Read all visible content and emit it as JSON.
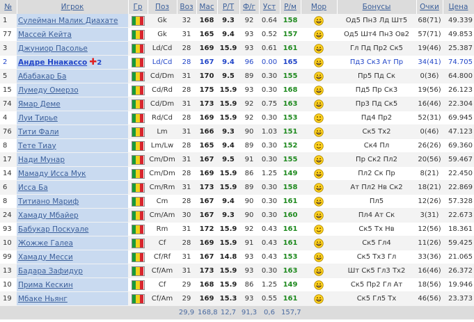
{
  "headers": {
    "num": "№",
    "player": "Игрок",
    "country": "Гр",
    "pos": "Поз",
    "age": "Воз",
    "mas": "Мас",
    "rt": "Р/Т",
    "fg": "Ф/г",
    "ust": "Уст",
    "rm": "Р/м",
    "mor": "Мор",
    "bonus": "Бонусы",
    "points": "Очки",
    "price": "Цена"
  },
  "flag_colors": [
    "#1a9a3a",
    "#f1d21b",
    "#d8262e"
  ],
  "rows": [
    {
      "num": "1",
      "name": "Сулейман Малик Диахате",
      "pos": "Gk",
      "age": "32",
      "mas": "168",
      "rt": "9.3",
      "fg": "92",
      "ust": "0.64",
      "rm": "158",
      "mor": "happy",
      "bonus": "Од5 Пн3 Лд Шт5",
      "points": "68(71)",
      "price": "49.339"
    },
    {
      "num": "77",
      "name": "Массей Кейта",
      "pos": "Gk",
      "age": "31",
      "mas": "165",
      "rt": "9.4",
      "fg": "93",
      "ust": "0.52",
      "rm": "157",
      "mor": "happy",
      "bonus": "Од5 Шт4 Пн3 Ов2",
      "points": "57(71)",
      "price": "49.853"
    },
    {
      "num": "3",
      "name": "Джуниор Пасолье",
      "pos": "Ld/Cd",
      "age": "28",
      "mas": "169",
      "rt": "15.9",
      "fg": "93",
      "ust": "0.61",
      "rm": "161",
      "mor": "happy",
      "bonus": "Гл Пд Пр2 Ск5",
      "points": "19(46)",
      "price": "25.387"
    },
    {
      "num": "2",
      "name": "Андре Ннакассо",
      "badge": "2",
      "pos": "Ld/Cd",
      "age": "28",
      "mas": "167",
      "rt": "9.4",
      "fg": "96",
      "ust": "0.00",
      "rm": "165",
      "mor": "happy",
      "bonus": "Пд3 Ск3 Ат Пр",
      "points": "34(41)",
      "price": "74.705",
      "highlight": true
    },
    {
      "num": "5",
      "name": "Абабакар Ба",
      "pos": "Cd/Dm",
      "age": "31",
      "mas": "170",
      "rt": "9.5",
      "fg": "89",
      "ust": "0.30",
      "rm": "155",
      "mor": "happy",
      "bonus": "Пр5 Пд Ск",
      "points": "0(36)",
      "price": "64.800"
    },
    {
      "num": "15",
      "name": "Лумеду Омерзо",
      "pos": "Cd/Rd",
      "age": "28",
      "mas": "175",
      "rt": "15.9",
      "fg": "93",
      "ust": "0.30",
      "rm": "168",
      "mor": "happy",
      "bonus": "Пд5 Пр Ск3",
      "points": "19(56)",
      "price": "26.123"
    },
    {
      "num": "74",
      "name": "Ямар Деме",
      "pos": "Cd/Dm",
      "age": "31",
      "mas": "173",
      "rt": "15.9",
      "fg": "92",
      "ust": "0.75",
      "rm": "163",
      "mor": "happy",
      "bonus": "Пр3 Пд Ск5",
      "points": "16(46)",
      "price": "22.304"
    },
    {
      "num": "4",
      "name": "Луи Тирье",
      "pos": "Rd/Cd",
      "age": "28",
      "mas": "169",
      "rt": "15.9",
      "fg": "92",
      "ust": "0.30",
      "rm": "153",
      "mor": "smile",
      "bonus": "Пд4 Пр2",
      "points": "52(31)",
      "price": "69.945"
    },
    {
      "num": "76",
      "name": "Тити Фали",
      "pos": "Lm",
      "age": "31",
      "mas": "166",
      "rt": "9.3",
      "fg": "90",
      "ust": "1.03",
      "rm": "151",
      "mor": "happy",
      "bonus": "Ск5 Тх2",
      "points": "0(46)",
      "price": "47.123"
    },
    {
      "num": "8",
      "name": "Тете Тиау",
      "pos": "Lm/Lw",
      "age": "28",
      "mas": "165",
      "rt": "9.4",
      "fg": "89",
      "ust": "0.30",
      "rm": "152",
      "mor": "smile",
      "bonus": "Ск4 Пл",
      "points": "26(26)",
      "price": "69.360"
    },
    {
      "num": "17",
      "name": "Нади Мунар",
      "pos": "Cm/Dm",
      "age": "31",
      "mas": "167",
      "rt": "9.5",
      "fg": "91",
      "ust": "0.30",
      "rm": "155",
      "mor": "happy",
      "bonus": "Пр Ск2 Пл2",
      "points": "20(56)",
      "price": "59.467"
    },
    {
      "num": "14",
      "name": "Мамаду Исса Мук",
      "pos": "Cm/Dm",
      "age": "28",
      "mas": "169",
      "rt": "15.9",
      "fg": "86",
      "ust": "1.25",
      "rm": "149",
      "mor": "happy",
      "bonus": "Пл2 Ск Пр",
      "points": "8(21)",
      "price": "22.450"
    },
    {
      "num": "6",
      "name": "Исса Ба",
      "pos": "Cm/Rm",
      "age": "31",
      "mas": "173",
      "rt": "15.9",
      "fg": "89",
      "ust": "0.30",
      "rm": "158",
      "mor": "happy",
      "bonus": "Ат Пл2 Нв Ск2",
      "points": "18(21)",
      "price": "22.869"
    },
    {
      "num": "8",
      "name": "Титиано Мариф",
      "pos": "Cm",
      "age": "28",
      "mas": "167",
      "rt": "9.4",
      "fg": "90",
      "ust": "0.30",
      "rm": "161",
      "mor": "happy",
      "bonus": "Пл5",
      "points": "12(26)",
      "price": "57.328"
    },
    {
      "num": "24",
      "name": "Хамаду Мбайер",
      "pos": "Cm/Am",
      "age": "30",
      "mas": "167",
      "rt": "9.3",
      "fg": "90",
      "ust": "0.30",
      "rm": "160",
      "mor": "happy",
      "bonus": "Пл4 Ат Ск",
      "points": "3(31)",
      "price": "22.673"
    },
    {
      "num": "93",
      "name": "Бабукар Поскуале",
      "pos": "Rm",
      "age": "31",
      "mas": "172",
      "rt": "15.9",
      "fg": "92",
      "ust": "0.43",
      "rm": "161",
      "mor": "smile",
      "bonus": "Ск5 Тх Нв",
      "points": "12(56)",
      "price": "18.361"
    },
    {
      "num": "10",
      "name": "Жожже Галеа",
      "pos": "Cf",
      "age": "28",
      "mas": "169",
      "rt": "15.9",
      "fg": "91",
      "ust": "0.43",
      "rm": "161",
      "mor": "happy",
      "bonus": "Ск5 Гл4",
      "points": "11(26)",
      "price": "59.425"
    },
    {
      "num": "99",
      "name": "Хамаду Месси",
      "pos": "Cf/Rf",
      "age": "31",
      "mas": "167",
      "rt": "14.8",
      "fg": "93",
      "ust": "0.43",
      "rm": "153",
      "mor": "happy",
      "bonus": "Ск5 Тх3 Гл",
      "points": "33(36)",
      "price": "21.065"
    },
    {
      "num": "13",
      "name": "Бадара Зафидур",
      "pos": "Cf/Am",
      "age": "31",
      "mas": "173",
      "rt": "15.9",
      "fg": "93",
      "ust": "0.30",
      "rm": "163",
      "mor": "happy",
      "bonus": "Шт Ск5 Гл3 Тх2",
      "points": "16(46)",
      "price": "26.372"
    },
    {
      "num": "10",
      "name": "Прима Кескин",
      "pos": "Cf",
      "age": "29",
      "mas": "168",
      "rt": "15.9",
      "fg": "86",
      "ust": "1.25",
      "rm": "149",
      "mor": "happy",
      "bonus": "Ск5 Пр2 Гл Ат",
      "points": "18(56)",
      "price": "19.946"
    },
    {
      "num": "19",
      "name": "Мбаке Ньянг",
      "pos": "Cf/Am",
      "age": "29",
      "mas": "169",
      "rt": "15.3",
      "fg": "93",
      "ust": "0.55",
      "rm": "161",
      "mor": "happy",
      "bonus": "Ск5 Гл5 Тх",
      "points": "46(56)",
      "price": "23.373"
    }
  ],
  "footer": {
    "age": "29,9",
    "mas": "168,8",
    "rt": "12,7",
    "fg": "91,3",
    "ust": "0,6",
    "rm": "157,7"
  }
}
